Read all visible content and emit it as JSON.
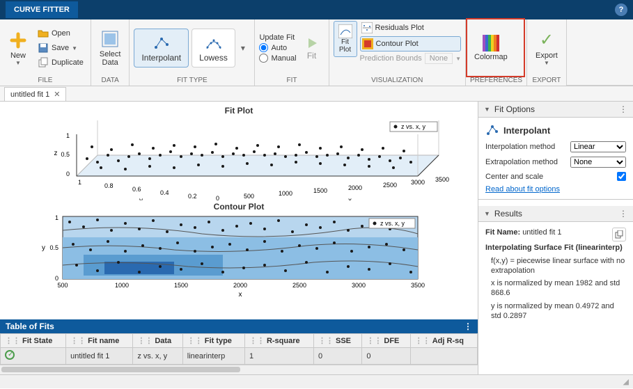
{
  "titlebar": {
    "app_tab": "CURVE FITTER"
  },
  "ribbon": {
    "file": {
      "label": "FILE",
      "new": "New",
      "open": "Open",
      "save": "Save",
      "duplicate": "Duplicate"
    },
    "data": {
      "label": "DATA",
      "select_data": "Select\nData"
    },
    "fit_type": {
      "label": "FIT TYPE",
      "interpolant": "Interpolant",
      "lowess": "Lowess"
    },
    "fit": {
      "label": "FIT",
      "update": "Update Fit",
      "auto": "Auto",
      "manual": "Manual",
      "btn": "Fit"
    },
    "viz": {
      "label": "VISUALIZATION",
      "fit_plot": "Fit\nPlot",
      "residuals": "Residuals Plot",
      "contour": "Contour Plot",
      "pred_bounds": "Prediction Bounds",
      "pred_val": "None"
    },
    "prefs": {
      "label": "PREFERENCES",
      "colormap": "Colormap"
    },
    "export": {
      "label": "EXPORT",
      "export": "Export"
    }
  },
  "doc_tab": {
    "name": "untitled fit 1"
  },
  "plots": {
    "fit_title": "Fit Plot",
    "fit_legend": "z vs. x, y",
    "fit_xlabel": "x",
    "fit_ylabel": "y",
    "fit_zlabel": "z",
    "contour_title": "Contour Plot",
    "contour_legend": "z vs. x, y",
    "contour_xlabel": "x",
    "contour_ylabel": "y"
  },
  "chart_data": [
    {
      "type": "scatter",
      "title": "Fit Plot",
      "xlabel": "x",
      "ylabel": "y",
      "zlabel": "z",
      "x_range": [
        0,
        3500
      ],
      "y_range": [
        0,
        1
      ],
      "z_range": [
        0,
        1
      ],
      "x_ticks": [
        500,
        1000,
        1500,
        2000,
        2500,
        3000,
        3500
      ],
      "y_ticks": [
        0,
        0.2,
        0.4,
        0.6,
        0.8,
        1
      ],
      "z_ticks": [
        0,
        0.5,
        1
      ],
      "series": [
        {
          "name": "z vs. x, y",
          "description": "3D scatter of ~300 points with interpolated surface"
        }
      ]
    },
    {
      "type": "heatmap",
      "title": "Contour Plot",
      "xlabel": "x",
      "ylabel": "y",
      "x_range": [
        500,
        3500
      ],
      "y_range": [
        0,
        1
      ],
      "x_ticks": [
        500,
        1000,
        1500,
        2000,
        2500,
        3000,
        3500
      ],
      "y_ticks": [
        0,
        0.5,
        1
      ],
      "series": [
        {
          "name": "z vs. x, y",
          "description": "filled contour with overlaid scatter"
        }
      ]
    }
  ],
  "table": {
    "header": "Table of Fits",
    "cols": {
      "state": "Fit State",
      "name": "Fit name",
      "data": "Data",
      "type": "Fit type",
      "rsq": "R-square",
      "sse": "SSE",
      "dfe": "DFE",
      "adjrsq": "Adj R-sq"
    },
    "rows": [
      {
        "state": "ok",
        "name": "untitled fit 1",
        "data": "z vs. x, y",
        "type": "linearinterp",
        "rsq": "1",
        "sse": "0",
        "dfe": "0",
        "adjrsq": ""
      }
    ]
  },
  "fit_options": {
    "header": "Fit Options",
    "title": "Interpolant",
    "interp_label": "Interpolation method",
    "interp_val": "Linear",
    "extrap_label": "Extrapolation method",
    "extrap_val": "None",
    "center_label": "Center and scale",
    "read_link": "Read about fit options"
  },
  "results": {
    "header": "Results",
    "fit_name_label": "Fit Name:",
    "fit_name": "untitled fit 1",
    "heading": "Interpolating Surface Fit (linearinterp)",
    "line1": "f(x,y) = piecewise linear surface with no extrapolation",
    "line2": "x is normalized by mean 1982 and std 868.6",
    "line3": "y is normalized by mean 0.4972 and std 0.2897"
  }
}
